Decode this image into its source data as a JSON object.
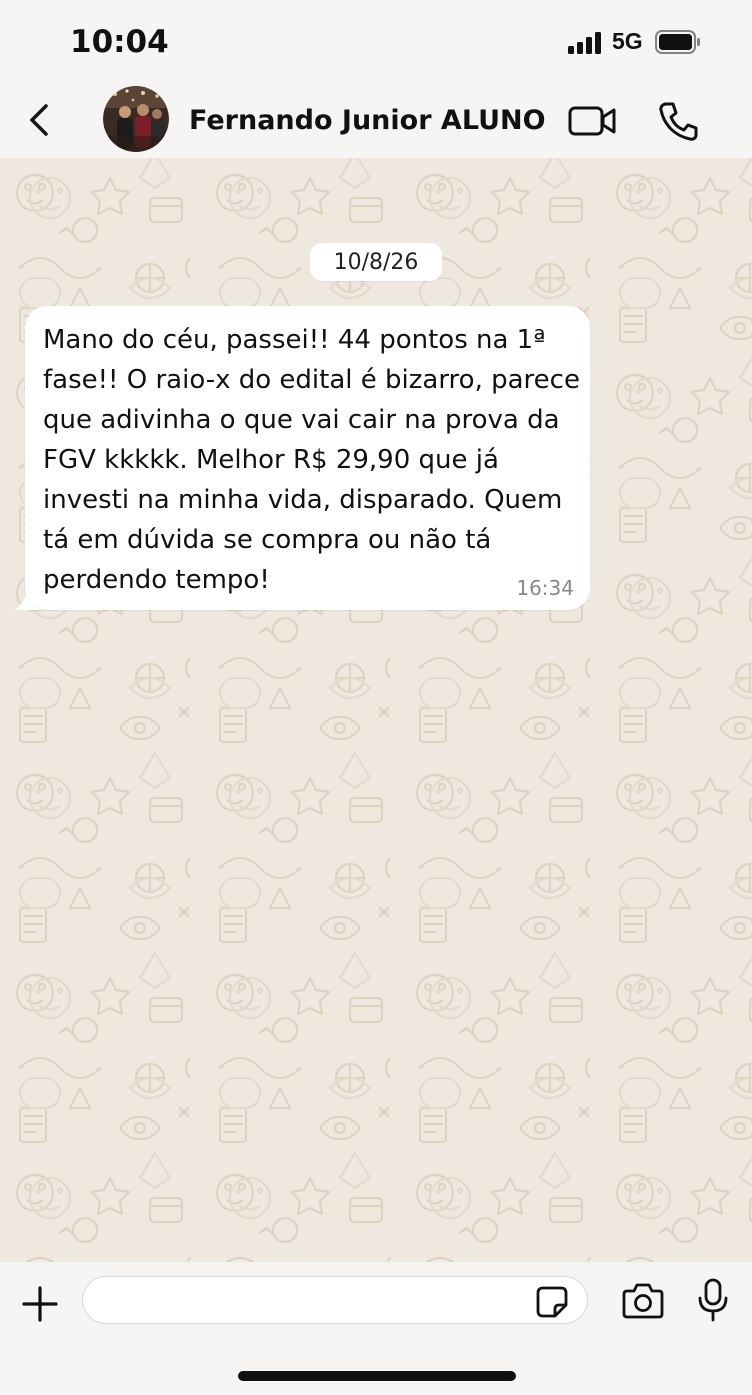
{
  "status_bar": {
    "time": "10:04",
    "network": "5G"
  },
  "header": {
    "contact_name": "Fernando Junior ALUNO",
    "icons": [
      "back-icon",
      "avatar",
      "video-call-icon",
      "phone-call-icon"
    ]
  },
  "chat": {
    "date_chip": "10/8/26",
    "messages": [
      {
        "text": "Mano do céu, passei!! 44 pontos na 1ª\nfase!! O raio-x do edital é bizarro, parece\nque adivinha o que vai cair na prova da\nFGV kkkkk. Melhor R$ 29,90 que já\ninvesti na minha vida, disparado. Quem\ntá em dúvida se compra ou não tá\nperdendo tempo!",
        "time": "16:34",
        "direction": "incoming"
      }
    ]
  },
  "composer": {
    "input_value": "",
    "input_placeholder": "",
    "icons": [
      "plus-icon",
      "sticker-icon",
      "camera-icon",
      "mic-icon"
    ]
  },
  "colors": {
    "wallpaper": "#efe8de",
    "doodle": "#ded5c7",
    "bubble": "#ffffff",
    "bars": "#f6f5f3"
  }
}
